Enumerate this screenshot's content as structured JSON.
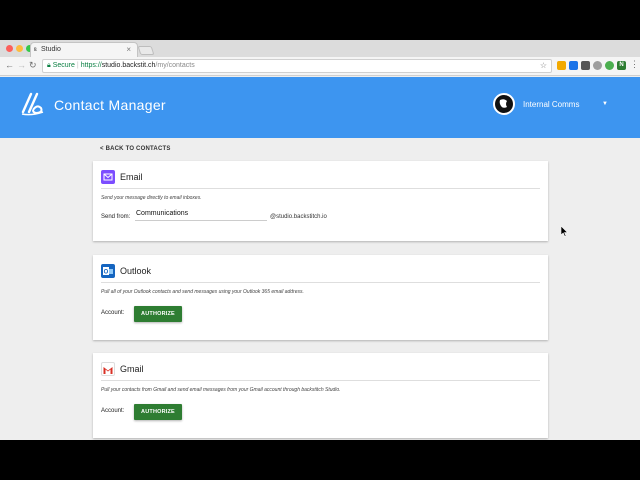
{
  "browser": {
    "tab_title": "Studio",
    "tab_icon": "backstitch-favicon",
    "secure_label": "Secure",
    "url_scheme": "https://",
    "url_host": "studio.backstit.ch",
    "url_path": "/my/contacts",
    "close_glyph": "×"
  },
  "app": {
    "title": "Contact Manager",
    "account_name": "Internal Comms",
    "brand_color": "#3d95f0",
    "button_color": "#2e7d32"
  },
  "back_link": "< BACK TO CONTACTS",
  "email": {
    "title": "Email",
    "description": "Send your message directly to email inboxes.",
    "send_from_label": "Send from:",
    "send_from_value": "Communications",
    "domain_suffix": "@studio.backstitch.io",
    "icon": "envelope-icon",
    "icon_color": "#7c4dff"
  },
  "outlook": {
    "title": "Outlook",
    "description": "Pull all of your Outlook contacts and send messages using your Outlook 365 email address.",
    "account_label": "Account:",
    "button": "AUTHORIZE",
    "icon": "outlook-icon",
    "icon_color": "#1565c0"
  },
  "gmail": {
    "title": "Gmail",
    "description": "Pull your contacts from Gmail and send email messages from your Gmail account through backstitch Studio.",
    "account_label": "Account:",
    "button": "AUTHORIZE",
    "icon": "gmail-icon",
    "icon_color": "#d93025"
  }
}
